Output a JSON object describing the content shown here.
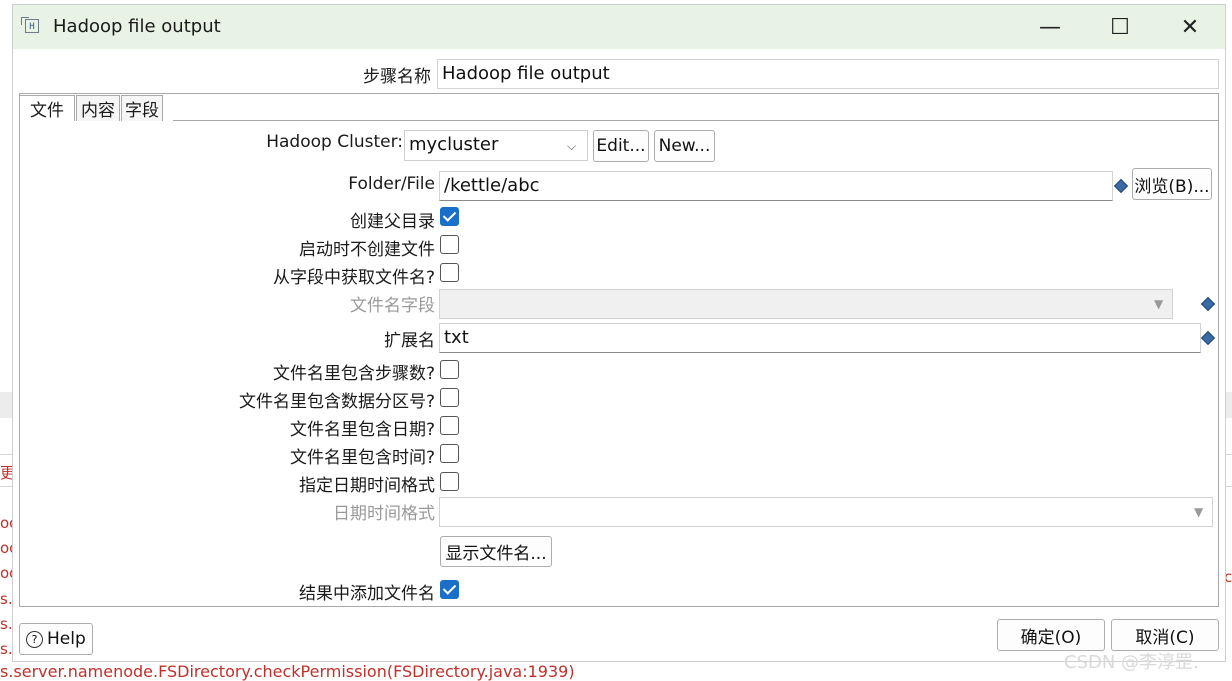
{
  "background": {
    "log_fragments": [
      "更",
      "oo",
      "oo",
      "oo",
      "s.s",
      "s.s",
      "s.s"
    ],
    "log_bottom": "s.server.namenode.FSDirectory.checkPermission(FSDirectory.java:1939)",
    "log_right": "c",
    "watermark": "CSDN @李淳罡."
  },
  "dialog": {
    "title": "Hadoop file output",
    "icon_text": "H",
    "window_controls": {
      "minimize": "—",
      "maximize": "☐",
      "close": "✕"
    },
    "step_name_label": "步骤名称",
    "step_name_value": "Hadoop file output",
    "tabs": [
      {
        "label": "文件",
        "active": true
      },
      {
        "label": "内容",
        "active": false
      },
      {
        "label": "字段",
        "active": false
      }
    ],
    "hadoop_cluster": {
      "label": "Hadoop Cluster:",
      "value": "mycluster",
      "edit": "Edit...",
      "new": "New..."
    },
    "folder_file": {
      "label": "Folder/File",
      "value": "/kettle/abc",
      "browse": "浏览(B)..."
    },
    "create_parent": {
      "label": "创建父目录",
      "checked": true
    },
    "no_create_at_start": {
      "label": "启动时不创建文件",
      "checked": false
    },
    "filename_from_field": {
      "label": "从字段中获取文件名?",
      "checked": false
    },
    "filename_field": {
      "label": "文件名字段",
      "value": ""
    },
    "extension": {
      "label": "扩展名",
      "value": "txt"
    },
    "include_step_nr": {
      "label": "文件名里包含步骤数?",
      "checked": false
    },
    "include_partition": {
      "label": "文件名里包含数据分区号?",
      "checked": false
    },
    "include_date": {
      "label": "文件名里包含日期?",
      "checked": false
    },
    "include_time": {
      "label": "文件名里包含时间?",
      "checked": false
    },
    "specify_format": {
      "label": "指定日期时间格式",
      "checked": false
    },
    "date_time_format": {
      "label": "日期时间格式",
      "value": ""
    },
    "show_filenames": "显示文件名...",
    "add_to_result": {
      "label": "结果中添加文件名",
      "checked": true
    },
    "help": "Help",
    "ok": "确定(O)",
    "cancel": "取消(C)"
  }
}
